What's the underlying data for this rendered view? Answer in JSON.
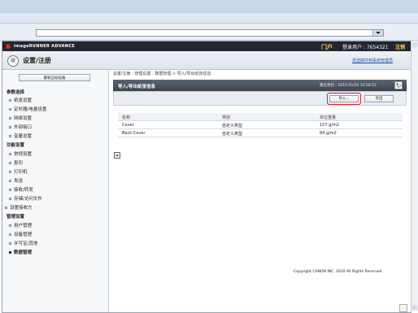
{
  "browser": {
    "address": ""
  },
  "header": {
    "brand": "imageRUNNER ADVANCE",
    "portal": "门户",
    "login_user": "登录用户 : 7654321",
    "logout": "注销",
    "page_title": "设置/注册",
    "notify_link": "发送邮件到系统管理员"
  },
  "sidebar": {
    "top_button": "重新启动设备",
    "sections": [
      {
        "label": "参数选择",
        "items": [
          "纸张设置",
          "定时器/电量设置",
          "网络设置",
          "外部接口",
          "音量设置"
        ]
      },
      {
        "label": "功能设置",
        "items": [
          "常规设置",
          "复印",
          "打印机",
          "发送",
          "接收/转发",
          "存储/访问文件"
        ]
      },
      {
        "label": "",
        "items": [
          "设置接收方"
        ]
      },
      {
        "label": "管理设置",
        "items": [
          "用户管理",
          "设备管理",
          "许可证/其他",
          "数据管理"
        ]
      }
    ],
    "active_item": "数据管理"
  },
  "main": {
    "breadcrumb": "设置/注册 : 管理设置 : 数据管理 > 导入/导出纸张信息",
    "panel_title": "导入/导出纸张信息",
    "last_updated": "最近更新 : 2010 05/20 10:58:52",
    "import_label": "导入...",
    "export_label": "导出",
    "table": {
      "headers": [
        "名称",
        "类别",
        "单位重量"
      ],
      "rows": [
        [
          "Cover",
          "自定义类型",
          "157 g/m2"
        ],
        [
          "Back Cover",
          "自定义类型",
          "64 g/m2"
        ]
      ]
    },
    "copyright": "Copyright CANON INC. 2010 All Rights Reserved"
  },
  "colors": {
    "highlight": "#e0262b",
    "link": "#1c56a8",
    "portal": "#ffd44a"
  }
}
